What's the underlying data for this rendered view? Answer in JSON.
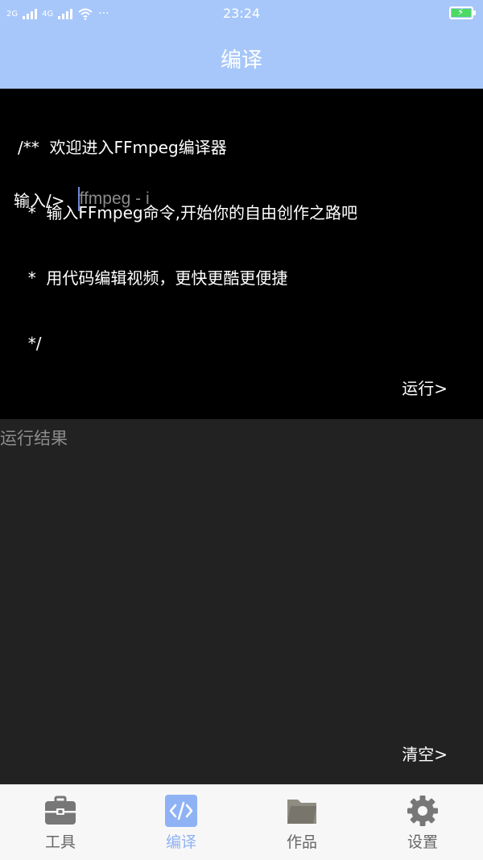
{
  "status_bar": {
    "network_left": "2G",
    "network_right": "4G",
    "time": "23:24",
    "more": "···"
  },
  "header": {
    "title": "编译"
  },
  "editor": {
    "comment_lines": [
      "/**  欢迎进入FFmpeg编译器",
      "  *  输入FFmpeg命令,开始你的自由创作之路吧",
      "  *  用代码编辑视频，更快更酷更便捷",
      "  */"
    ],
    "prompt_label": "输入/>",
    "input_value": "",
    "input_placeholder": "ffmpeg - i",
    "run_label": "运行>"
  },
  "output": {
    "label": "运行结果",
    "clear_label": "清空>"
  },
  "tabs": [
    {
      "label": "工具",
      "icon": "toolbox-icon",
      "active": false
    },
    {
      "label": "编译",
      "icon": "code-icon",
      "active": true
    },
    {
      "label": "作品",
      "icon": "folder-icon",
      "active": false
    },
    {
      "label": "设置",
      "icon": "gear-icon",
      "active": false
    }
  ],
  "colors": {
    "header_bg": "#a7c7fa",
    "editor_bg": "#000000",
    "output_bg": "#222222",
    "tab_active": "#8fb2f5",
    "tab_inactive": "#666666"
  }
}
